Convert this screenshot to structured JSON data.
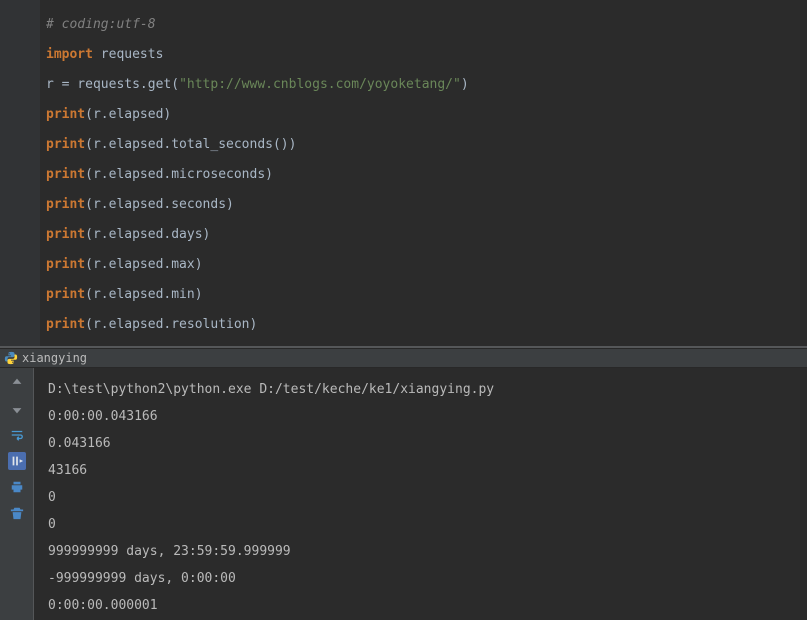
{
  "code": {
    "comment": "# coding:utf-8",
    "import_kw": "import",
    "import_mod": " requests",
    "assign": "r = requests.get(",
    "url": "\"http://www.cnblogs.com/yoyoketang/\"",
    "assign_close": ")",
    "print_kw": "print",
    "p1": "(r.elapsed)",
    "p2": "(r.elapsed.total_seconds())",
    "p3": "(r.elapsed.microseconds)",
    "p4": "(r.elapsed.seconds)",
    "p5": "(r.elapsed.days)",
    "p6": "(r.elapsed.max)",
    "p7": "(r.elapsed.min)",
    "p8": "(r.elapsed.resolution)"
  },
  "run_tab": {
    "label": "xiangying"
  },
  "console": {
    "cmd": "D:\\test\\python2\\python.exe D:/test/keche/ke1/xiangying.py",
    "l1": "0:00:00.043166",
    "l2": "0.043166",
    "l3": "43166",
    "l4": "0",
    "l5": "0",
    "l6": "999999999 days, 23:59:59.999999",
    "l7": "-999999999 days, 0:00:00",
    "l8": "0:00:00.000001"
  }
}
